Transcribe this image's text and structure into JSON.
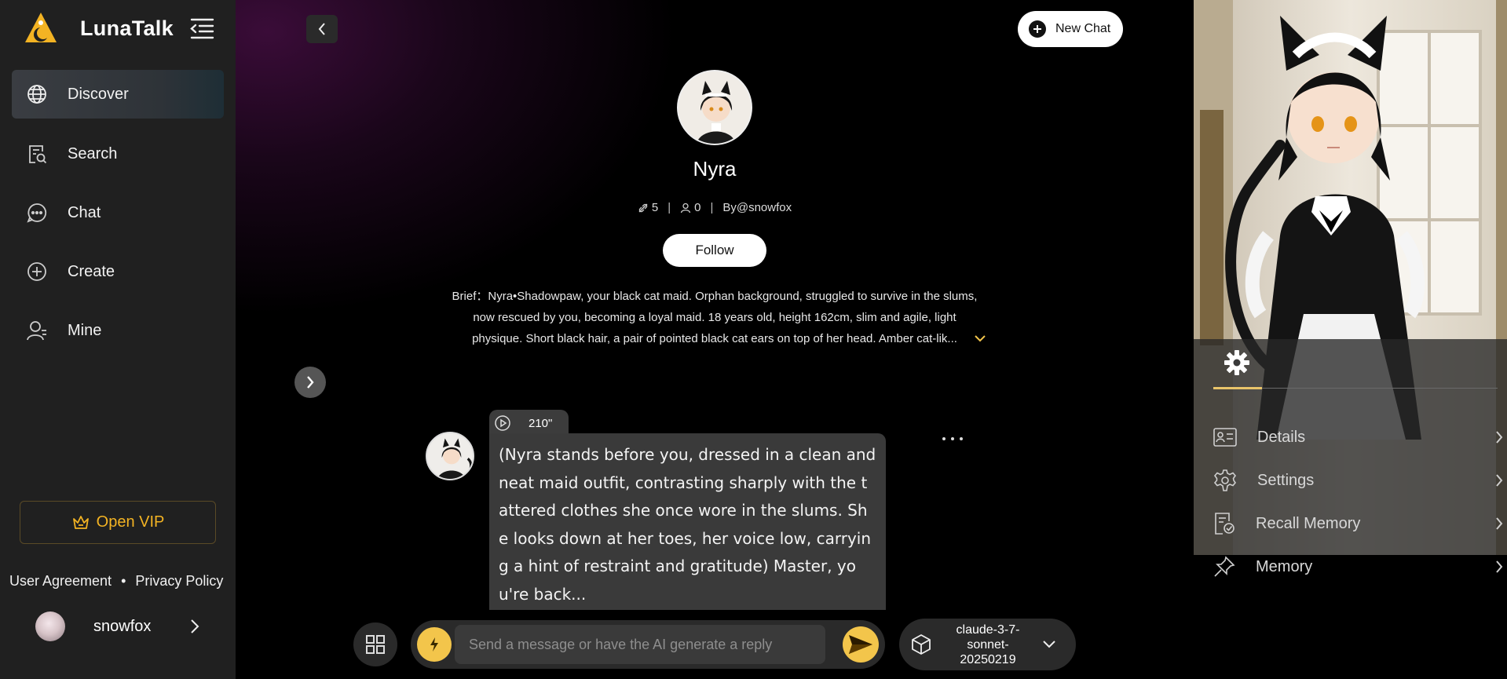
{
  "sidebar": {
    "brand": "LunaTalk",
    "nav": [
      {
        "label": "Discover",
        "icon": "globe-icon",
        "active": true
      },
      {
        "label": "Search",
        "icon": "search-doc-icon",
        "active": false
      },
      {
        "label": "Chat",
        "icon": "chat-bubble-icon",
        "active": false
      },
      {
        "label": "Create",
        "icon": "plus-circle-icon",
        "active": false
      },
      {
        "label": "Mine",
        "icon": "user-icon",
        "active": false
      }
    ],
    "vip_label": "Open VIP",
    "user_agreement": "User Agreement",
    "privacy_policy": "Privacy Policy",
    "username": "snowfox"
  },
  "header": {
    "new_chat_label": "New Chat"
  },
  "character": {
    "name": "Nyra",
    "likes": "5",
    "followers": "0",
    "author": "By@snowfox",
    "follow_label": "Follow",
    "brief": "Brief：Nyra•Shadowpaw, your black cat maid. Orphan background, struggled to survive in the slums, now rescued by you, becoming a loyal maid. 18 years old, height 162cm, slim and agile, light physique. Short black hair, a pair of pointed black cat ears on top of her head. Amber cat-lik..."
  },
  "message": {
    "audio_duration": "210\"",
    "text": "(Nyra stands before you, dressed in a clean and neat maid outfit, contrasting sharply with the tattered clothes she once wore in the slums. She looks down at her toes, her voice low, carrying a hint of restraint and gratitude) Master, you're back..."
  },
  "composer": {
    "placeholder": "Send a message or have the AI generate a reply",
    "model_line1": "claude-3-7-sonnet-",
    "model_line2": "20250219"
  },
  "right_panel": {
    "items": [
      {
        "label": "Details",
        "icon": "id-card-icon"
      },
      {
        "label": "Settings",
        "icon": "gear-icon"
      },
      {
        "label": "Recall Memory",
        "icon": "recall-doc-icon"
      },
      {
        "label": "Memory",
        "icon": "pin-icon"
      }
    ]
  },
  "colors": {
    "accent": "#f3c54b",
    "vip": "#f3b323",
    "sidebar_bg": "#202020"
  }
}
